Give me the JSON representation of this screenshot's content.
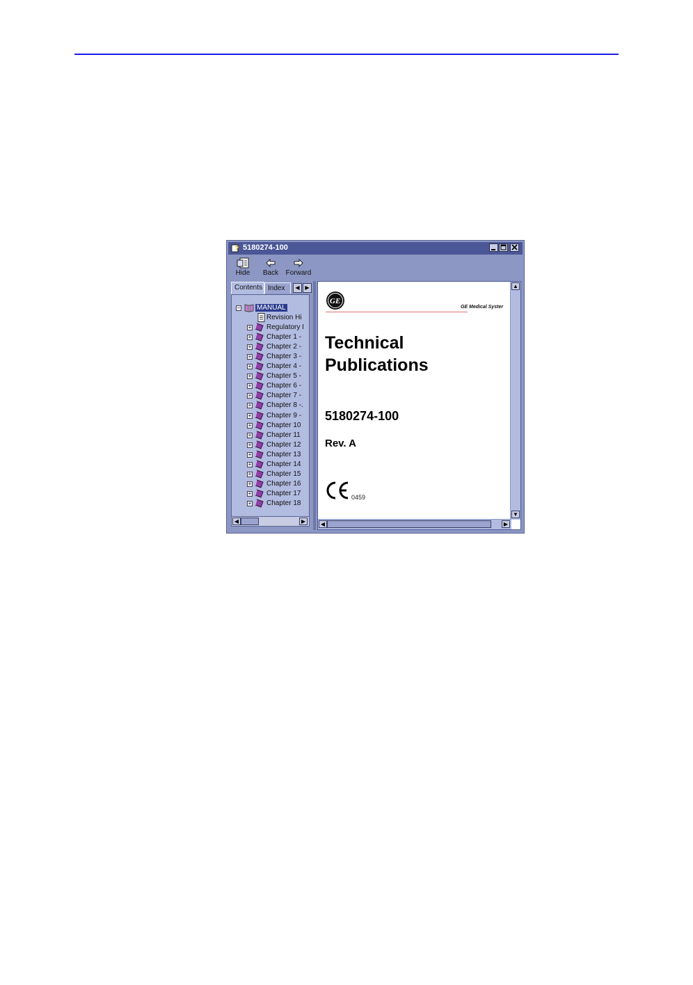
{
  "window": {
    "title": "5180274-100",
    "buttons": {
      "minimize": "minimize",
      "maximize": "maximize",
      "close": "close"
    }
  },
  "toolbar": {
    "hide_label": "Hide",
    "back_label": "Back",
    "forward_label": "Forward"
  },
  "nav_tabs": [
    {
      "label": "Contents",
      "active": true
    },
    {
      "label": "Index",
      "active": false
    }
  ],
  "tree": {
    "root": "MANUAL",
    "items": [
      {
        "label": "Revision Hi",
        "icon": "page-icon"
      },
      {
        "label": "Regulatory I",
        "icon": "book-icon"
      },
      {
        "label": "Chapter 1 -",
        "icon": "book-icon"
      },
      {
        "label": "Chapter 2 -",
        "icon": "book-icon"
      },
      {
        "label": "Chapter 3 -",
        "icon": "book-icon"
      },
      {
        "label": "Chapter 4 -",
        "icon": "book-icon"
      },
      {
        "label": "Chapter 5 -",
        "icon": "book-icon"
      },
      {
        "label": "Chapter 6 -",
        "icon": "book-icon"
      },
      {
        "label": "Chapter 7 -",
        "icon": "book-icon"
      },
      {
        "label": "Chapter 8 -.",
        "icon": "book-icon"
      },
      {
        "label": "Chapter 9 -",
        "icon": "book-icon"
      },
      {
        "label": "Chapter 10",
        "icon": "book-icon"
      },
      {
        "label": "Chapter 11",
        "icon": "book-icon"
      },
      {
        "label": "Chapter 12",
        "icon": "book-icon"
      },
      {
        "label": "Chapter 13",
        "icon": "book-icon"
      },
      {
        "label": "Chapter 14",
        "icon": "book-icon"
      },
      {
        "label": "Chapter 15",
        "icon": "book-icon"
      },
      {
        "label": "Chapter 16",
        "icon": "book-icon"
      },
      {
        "label": "Chapter 17",
        "icon": "book-icon"
      },
      {
        "label": "Chapter 18",
        "icon": "book-icon"
      }
    ]
  },
  "document": {
    "header_company": "GE Medical Syster",
    "title_line1": "Technical",
    "title_line2": "Publications",
    "part_number": "5180274-100",
    "revision": "Rev. A",
    "notified_body": "0459"
  },
  "colors": {
    "title_bar": "#4b5796",
    "window_frame": "#8c97c4",
    "tree_background": "#b2bbe0",
    "rule_blue": "#1a1ae6",
    "rule_red": "#e07070"
  }
}
